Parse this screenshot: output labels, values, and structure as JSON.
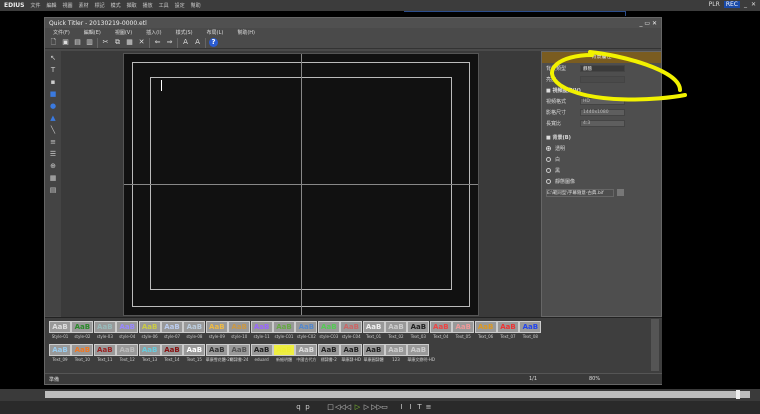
{
  "app": {
    "logo": "EDIUS",
    "menu": [
      "文件",
      "編輯",
      "視圖",
      "素材",
      "標記",
      "模式",
      "擷取",
      "播放",
      "工具",
      "設定",
      "幫助"
    ],
    "plr": "PLR",
    "rec": "REC"
  },
  "titler": {
    "title": "Quick Titler - 20130219-0000.etl",
    "menu": [
      "文件(F)",
      "編輯(E)",
      "視圖(V)",
      "插入(I)",
      "樣式(S)",
      "布局(L)",
      "幫助(H)"
    ]
  },
  "panel": {
    "header": "背景屬性",
    "bg_type_label": "背景類型",
    "bg_type_value": "靜態",
    "brightness_label": "亮度",
    "video_section": "視頻設定(V)",
    "video_format_label": "視頻格式",
    "video_format_value": "HD",
    "frame_size_label": "影格尺寸",
    "frame_size_value": "1440x1080",
    "aspect_label": "長寬比",
    "aspect_value": "4:3",
    "bg_section": "背景(B)",
    "bg_options": [
      "透明",
      "白",
      "黑",
      "靜態圖像"
    ],
    "bg_selected": "透明",
    "image_path": "E:\\範同型\\字幕隨意-古典.bif"
  },
  "styles": [
    "Style-01",
    "style-02",
    "style-03",
    "style-04",
    "style-06",
    "style-07",
    "style-08",
    "style-09",
    "style-10",
    "style-11",
    "style-C01",
    "style-C02",
    "style-C03",
    "style-C04",
    "Text_01",
    "Text_02",
    "Text_03",
    "Text_04",
    "Text_05",
    "Text_06",
    "Text_07",
    "Text_08",
    "Text_09",
    "Text_10",
    "Text_11",
    "Text_12",
    "Text_13",
    "Text_14",
    "Text_15",
    "華康雪花體-20",
    "標隸書-24",
    "eduard",
    "新細明體",
    "中國古代方",
    "標隸書-2",
    "華康隸-HD",
    "華康圓隸體",
    "123",
    "華康文鼎明-HD"
  ],
  "style_sample": "AaB",
  "status": {
    "text": "準備",
    "page": "1/1",
    "zoom": "80%"
  },
  "colors": {
    "panel_header": "#7a5c20",
    "annotation": "#f2f200",
    "rec": "#1a4aa8"
  }
}
